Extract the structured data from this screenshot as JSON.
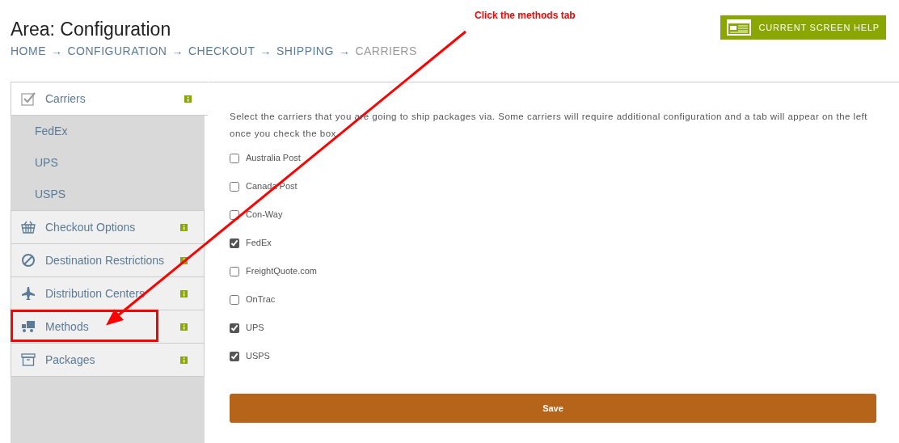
{
  "header": {
    "title": "Area: Configuration",
    "separator": "→",
    "breadcrumb": [
      {
        "label": "HOME",
        "current": false
      },
      {
        "label": "CONFIGURATION",
        "current": false
      },
      {
        "label": "CHECKOUT",
        "current": false
      },
      {
        "label": "SHIPPING",
        "current": false
      },
      {
        "label": "CARRIERS",
        "current": true
      }
    ]
  },
  "help_button": {
    "label": "CURRENT SCREEN HELP"
  },
  "annotation": {
    "text": "Click the methods tab"
  },
  "sidebar": {
    "tabs": [
      {
        "kind": "check",
        "label": "Carriers",
        "selected": true,
        "highlighted": false,
        "expanded": true,
        "children": [
          {
            "label": "FedEx"
          },
          {
            "label": "UPS"
          },
          {
            "label": "USPS"
          }
        ]
      },
      {
        "kind": "basket",
        "label": "Checkout Options",
        "selected": false,
        "highlighted": false
      },
      {
        "kind": "ban",
        "label": "Destination Restrictions",
        "selected": false,
        "highlighted": false
      },
      {
        "kind": "plane",
        "label": "Distribution Centers",
        "selected": false,
        "highlighted": false
      },
      {
        "kind": "truck",
        "label": "Methods",
        "selected": false,
        "highlighted": true
      },
      {
        "kind": "box",
        "label": "Packages",
        "selected": false,
        "highlighted": false
      }
    ]
  },
  "content": {
    "intro": "Select the carriers that you are going to ship packages via. Some carriers will require additional configuration and a tab will appear on the left once you check the box.",
    "carriers": [
      {
        "label": "Australia Post",
        "checked": false
      },
      {
        "label": "Canada Post",
        "checked": false
      },
      {
        "label": "Con-Way",
        "checked": false
      },
      {
        "label": "FedEx",
        "checked": true
      },
      {
        "label": "FreightQuote.com",
        "checked": false
      },
      {
        "label": "OnTrac",
        "checked": false
      },
      {
        "label": "UPS",
        "checked": true
      },
      {
        "label": "USPS",
        "checked": true
      }
    ],
    "save_button": "Save"
  }
}
